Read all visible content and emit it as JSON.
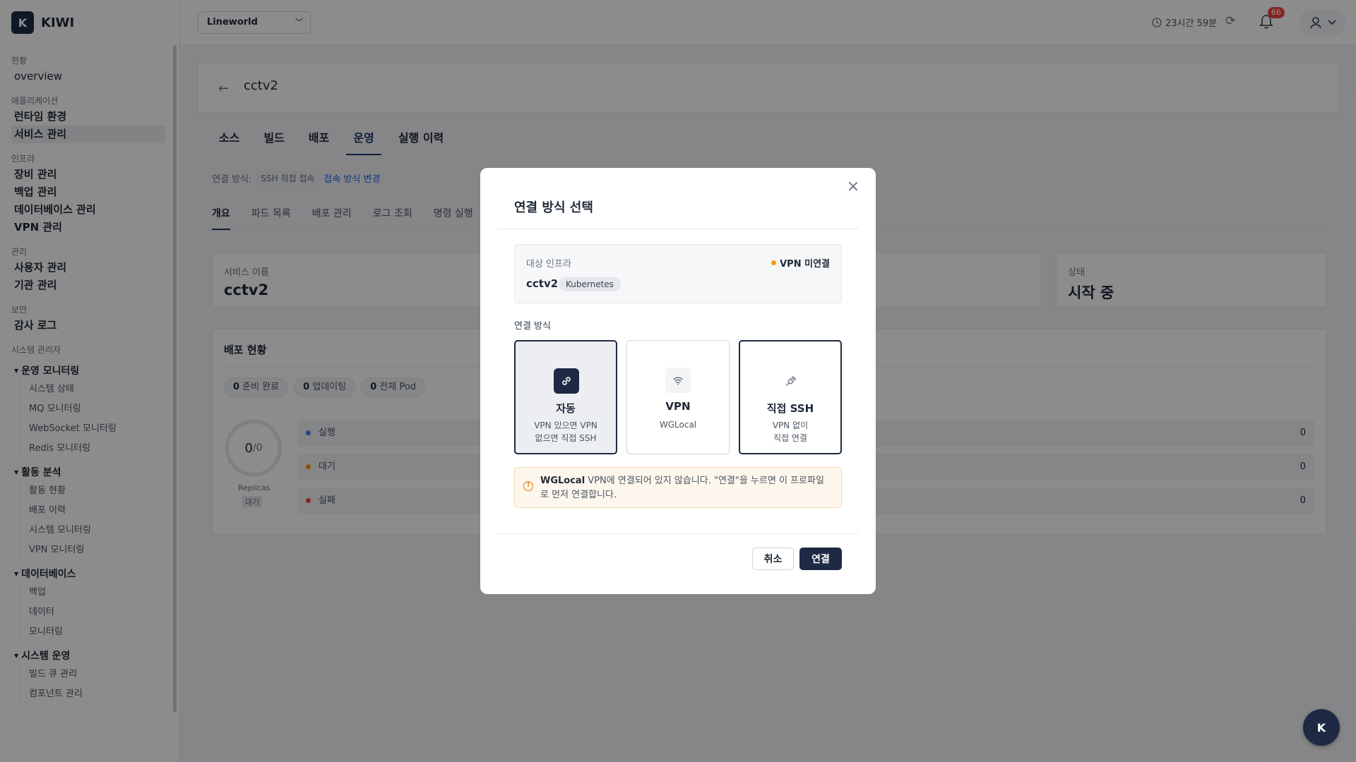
{
  "app": {
    "logo_letter": "K",
    "name": "KIWI"
  },
  "header": {
    "org": "Lineworld",
    "session_time": "23시간 59분",
    "notification_count": "66"
  },
  "sidebar": {
    "groups": [
      {
        "label": "현황",
        "items": [
          "overview"
        ]
      },
      {
        "label": "애플리케이션",
        "items": [
          "런타임 환경",
          "서비스 관리"
        ]
      },
      {
        "label": "인프라",
        "items": [
          "장비 관리",
          "백업 관리",
          "데이터베이스 관리",
          "VPN 관리"
        ]
      },
      {
        "label": "관리",
        "items": [
          "사용자 관리",
          "기관 관리"
        ]
      },
      {
        "label": "보안",
        "items": [
          "감사 로그"
        ]
      },
      {
        "label": "시스템 관리자"
      }
    ],
    "sections": [
      {
        "label": "운영 모니터링",
        "items": [
          "시스템 상태",
          "MQ 모니터링",
          "WebSocket 모니터링",
          "Redis 모니터링"
        ]
      },
      {
        "label": "활동 분석",
        "items": [
          "활동 현황",
          "배포 이력",
          "시스템 모니터링",
          "VPN 모니터링"
        ]
      },
      {
        "label": "데이터베이스",
        "items": [
          "백업",
          "데이터",
          "모니터링"
        ]
      },
      {
        "label": "시스템 운영",
        "items": [
          "빌드 큐 관리",
          "컴포넌트 관리"
        ]
      }
    ]
  },
  "page": {
    "title": "cctv2",
    "tabs": [
      "소스",
      "빌드",
      "배포",
      "운영",
      "실행 이력"
    ],
    "active_tab": "운영",
    "conn_label": "연결 방식:",
    "conn_value": "SSH 직접 접속",
    "conn_change": "접속 방식 변경",
    "sub_tabs": [
      "개요",
      "파드 목록",
      "배포 관리",
      "로그 조회",
      "명령 실행"
    ],
    "cards": {
      "service_name_label": "서비스 이름",
      "service_name": "cctv2",
      "status_label": "상태",
      "status": "시작 중"
    },
    "deploy": {
      "title": "배포 현황",
      "pills": [
        {
          "n": "0",
          "label": "준비 완료"
        },
        {
          "n": "0",
          "label": "업데이팅"
        },
        {
          "n": "0",
          "label": "전체 Pod"
        }
      ],
      "ring_value": "0",
      "ring_total": "/0",
      "replicas_label": "Replicas",
      "replicas_state": "대기",
      "rows": [
        {
          "label": "실행",
          "value": "0",
          "color": "#3b82f6"
        },
        {
          "label": "대기",
          "value": "0",
          "color": "#f59e0b"
        },
        {
          "label": "실패",
          "value": "0",
          "color": "#ef4444"
        }
      ]
    }
  },
  "modal": {
    "title": "연결 방식 선택",
    "infra_label": "대상 인프라",
    "vpn_status": "VPN 미연결",
    "infra_name": "cctv2",
    "infra_type": "Kubernetes",
    "method_label": "연결 방식",
    "options": [
      {
        "title": "자동",
        "desc1": "VPN 있으면 VPN",
        "desc2": "없으면 직접 SSH"
      },
      {
        "title": "VPN",
        "desc1": "WGLocal",
        "desc2": ""
      },
      {
        "title": "직접 SSH",
        "desc1": "VPN 없이",
        "desc2": "직접 연결"
      }
    ],
    "warning_profile": "WGLocal",
    "warning_text": " VPN에 연결되어 있지 않습니다. \"연결\"을 누르면 이 프로파일로 먼저 연결합니다.",
    "cancel": "취소",
    "confirm": "연결"
  },
  "fab_letter": "K"
}
